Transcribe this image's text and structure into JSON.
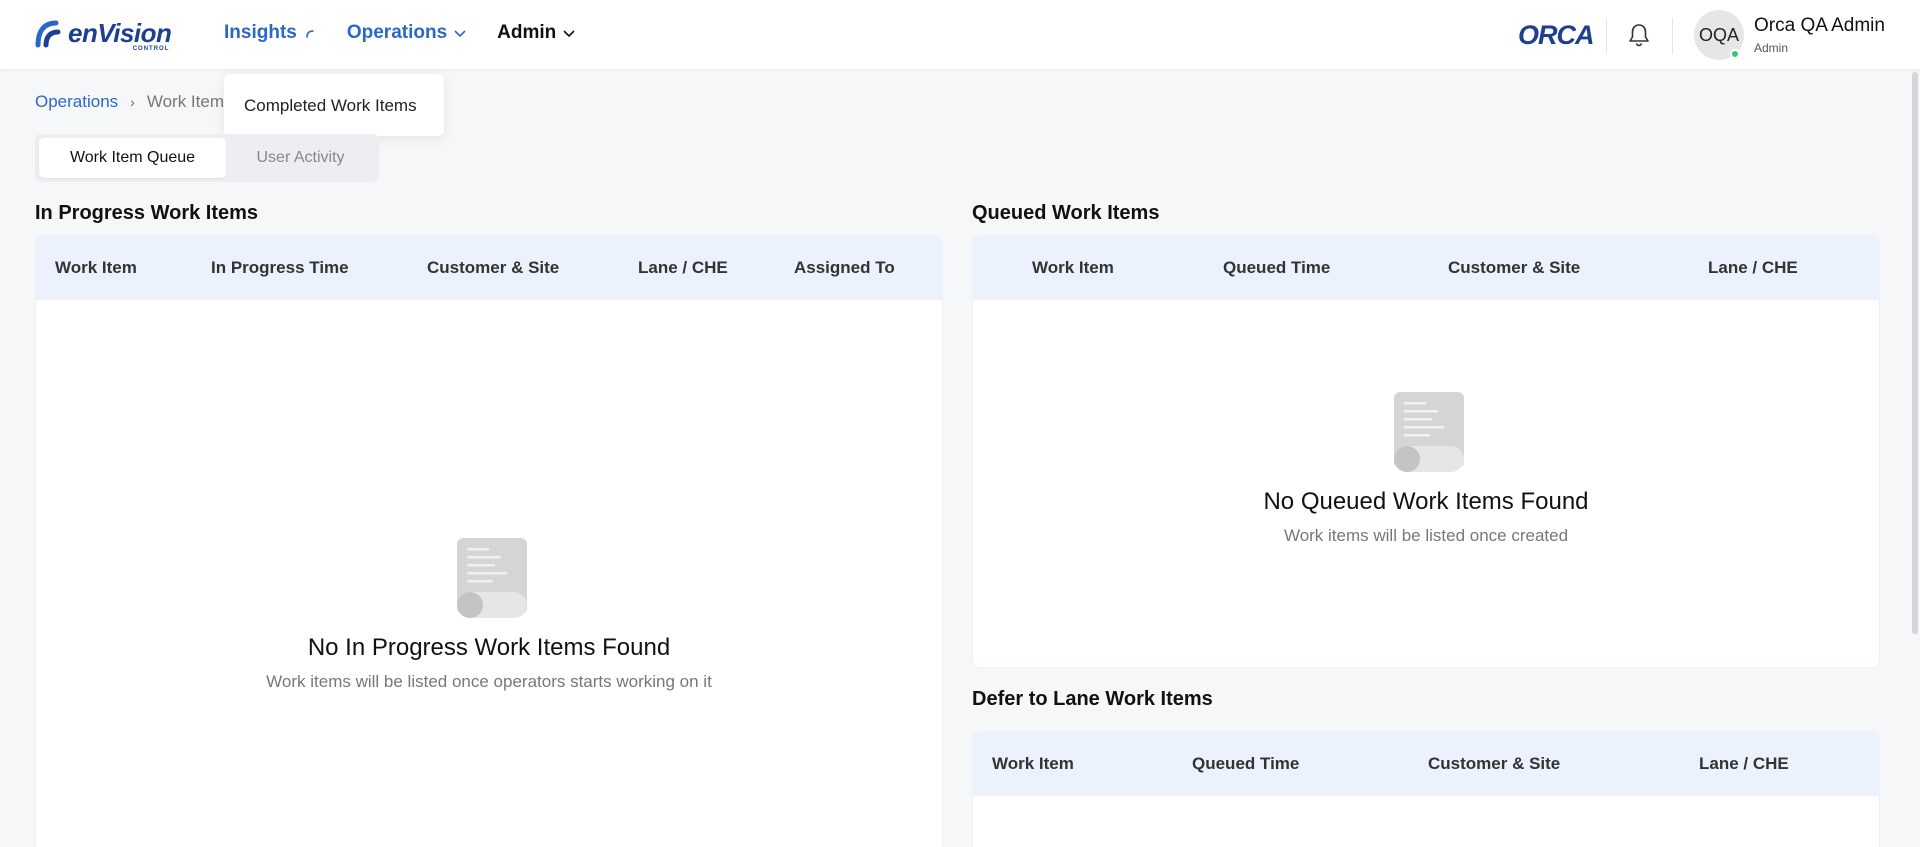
{
  "header": {
    "brand": "enVision",
    "brand_sub": "CONTROL",
    "nav": [
      {
        "label": "Insights"
      },
      {
        "label": "Operations"
      },
      {
        "label": "Admin"
      }
    ],
    "partner_logo": "ORCA",
    "user": {
      "initials": "OQA",
      "name": "Orca QA Admin",
      "role": "Admin"
    }
  },
  "dropdown": {
    "items": [
      "Completed Work Items"
    ]
  },
  "breadcrumb": {
    "parent": "Operations",
    "current": "Work Item"
  },
  "tabs": [
    {
      "label": "Work Item Queue",
      "active": true
    },
    {
      "label": "User Activity",
      "active": false
    }
  ],
  "in_progress": {
    "title": "In Progress Work Items",
    "columns": [
      "Work Item",
      "In Progress Time",
      "Customer & Site",
      "Lane / CHE",
      "Assigned To"
    ],
    "empty_title": "No In Progress Work Items Found",
    "empty_sub": "Work items will be listed once operators starts working on it"
  },
  "queued": {
    "title": "Queued Work Items",
    "columns": [
      "Work Item",
      "Queued Time",
      "Customer & Site",
      "Lane / CHE"
    ],
    "empty_title": "No Queued Work Items Found",
    "empty_sub": "Work items will be listed once created"
  },
  "defer": {
    "title": "Defer to Lane Work Items",
    "columns": [
      "Work Item",
      "Queued Time",
      "Customer & Site",
      "Lane / CHE"
    ]
  },
  "colors": {
    "accent": "#2a68c8",
    "brand": "#1c3f8f",
    "table_header": "#ebf1fd",
    "online": "#2ecc71"
  }
}
